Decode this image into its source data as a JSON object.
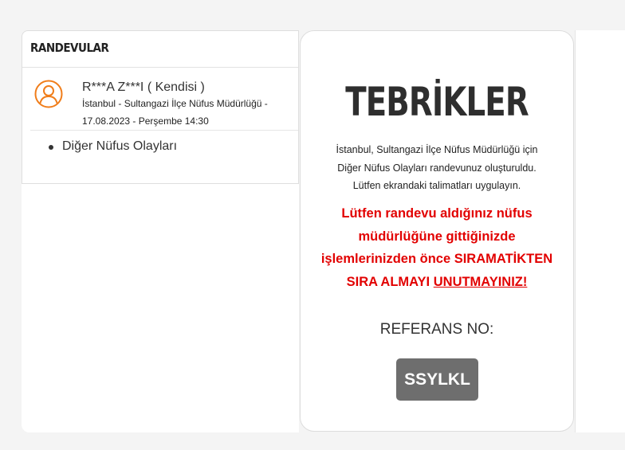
{
  "appointments_panel": {
    "title": "RANDEVULAR",
    "appointment": {
      "name": "R***A Z***I ( Kendisi )",
      "location": "İstanbul - Sultangazi İlçe Nüfus Müdürlüğü -",
      "datetime": "17.08.2023 - Perşembe 14:30"
    },
    "events": [
      "Diğer Nüfus Olayları"
    ]
  },
  "confirmation": {
    "heading": "TEBRİKLER",
    "info_lines": [
      "İstanbul, Sultangazi İlçe Nüfus Müdürlüğü için",
      "Diğer Nüfus Olayları randevunuz oluşturuldu.",
      "Lütfen ekrandaki talimatları uygulayın."
    ],
    "warning_lines": [
      "Lütfen randevu aldığınız nüfus",
      "müdürlüğüne gittiğinizde",
      "işlemlerinizden önce SIRAMATİKTEN",
      "SIRA ALMAYI"
    ],
    "warning_emphasis": "UNUTMAYINIZ!",
    "reference_label": "REFERANS NO:",
    "reference_code": "SSYLKL"
  },
  "colors": {
    "accent_orange": "#f07d1a",
    "warning_red": "#e20000",
    "code_badge_bg": "#6e6e6e"
  },
  "icons": {
    "avatar": "user-icon"
  }
}
